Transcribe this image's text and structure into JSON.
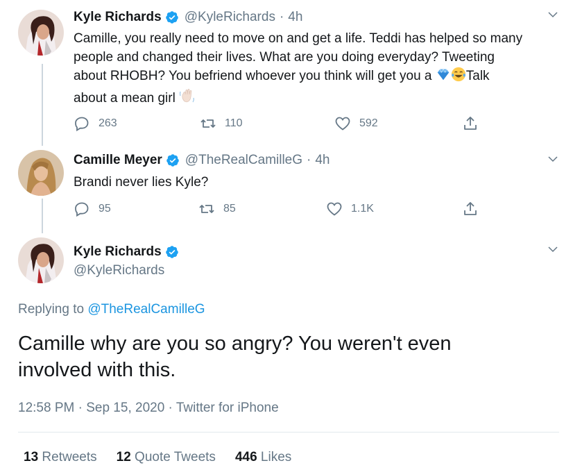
{
  "colors": {
    "text": "#14171a",
    "secondary": "#657786",
    "link": "#1b95e0",
    "verified": "#1da1f2",
    "divider": "#e1e8ed"
  },
  "tweets": [
    {
      "name": "Kyle Richards",
      "handle": "@KyleRichards",
      "time": "4h",
      "text_lines": [
        "Camille, you really need to move on and get a life. Teddi has helped so many",
        "people and changed their lives. What are you doing everyday? Tweeting",
        "about RHOBH? You befriend whoever you think will get you a ",
        "Talk",
        "about a mean girl "
      ],
      "emojis": [
        "gem-emoji",
        "tears-of-joy-emoji",
        "waving-hand-emoji"
      ],
      "replies": "263",
      "retweets": "110",
      "likes": "592"
    },
    {
      "name": "Camille Meyer",
      "handle": "@TheRealCamilleG",
      "time": "4h",
      "text_lines": [
        "Brandi never lies Kyle?"
      ],
      "replies": "95",
      "retweets": "85",
      "likes": "1.1K"
    }
  ],
  "main": {
    "name": "Kyle Richards",
    "handle": "@KyleRichards",
    "replying_prefix": "Replying to ",
    "replying_to": "@TheRealCamilleG",
    "text_lines": [
      "Camille why are you so angry? You weren't even",
      "involved with this."
    ],
    "time": "12:58 PM",
    "date": "Sep 15, 2020",
    "source": "Twitter for iPhone",
    "sep": "·",
    "stats": [
      {
        "count": "13",
        "label": "Retweets"
      },
      {
        "count": "12",
        "label": "Quote Tweets"
      },
      {
        "count": "446",
        "label": "Likes"
      }
    ]
  },
  "dot": "·"
}
